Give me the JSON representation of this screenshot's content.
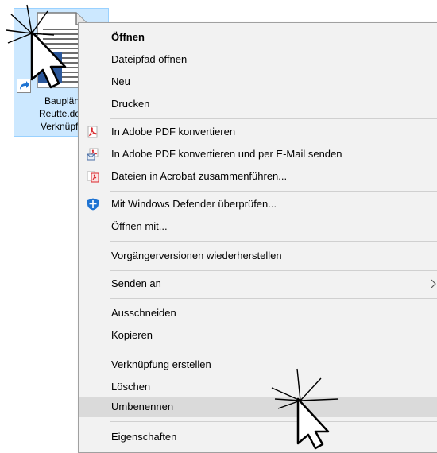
{
  "desktop": {
    "file": {
      "label_lines": [
        "Bauplän",
        "Reutte.doc",
        "Verknüpfu"
      ],
      "overlay_letter": "R",
      "icon": "document-icon",
      "shortcut_icon": "shortcut-arrow-icon"
    }
  },
  "context_menu": {
    "items": [
      {
        "label": "Öffnen",
        "bold": true
      },
      {
        "label": "Dateipfad öffnen"
      },
      {
        "label": "Neu"
      },
      {
        "label": "Drucken"
      },
      {
        "label": "In Adobe PDF konvertieren",
        "icon": "adobe-pdf-icon"
      },
      {
        "label": "In Adobe PDF konvertieren und per E-Mail senden",
        "icon": "adobe-pdf-email-icon"
      },
      {
        "label": "Dateien in Acrobat zusammenführen...",
        "icon": "acrobat-combine-icon"
      },
      {
        "label": "Mit Windows Defender überprüfen...",
        "icon": "windows-defender-icon"
      },
      {
        "label": "Öffnen mit..."
      },
      {
        "label": "Vorgängerversionen wiederherstellen"
      },
      {
        "label": "Senden an",
        "submenu": true
      },
      {
        "label": "Ausschneiden"
      },
      {
        "label": "Kopieren"
      },
      {
        "label": "Verknüpfung erstellen"
      },
      {
        "label": "Löschen"
      },
      {
        "label": "Umbenennen",
        "highlighted": true
      },
      {
        "label": "Eigenschaften"
      }
    ]
  },
  "colors": {
    "selection_fill": "#cce8ff",
    "menu_bg": "#f2f2f2",
    "hover_bg": "#dadada",
    "pdf_red": "#d9262b",
    "defender_blue": "#1e73d2"
  }
}
